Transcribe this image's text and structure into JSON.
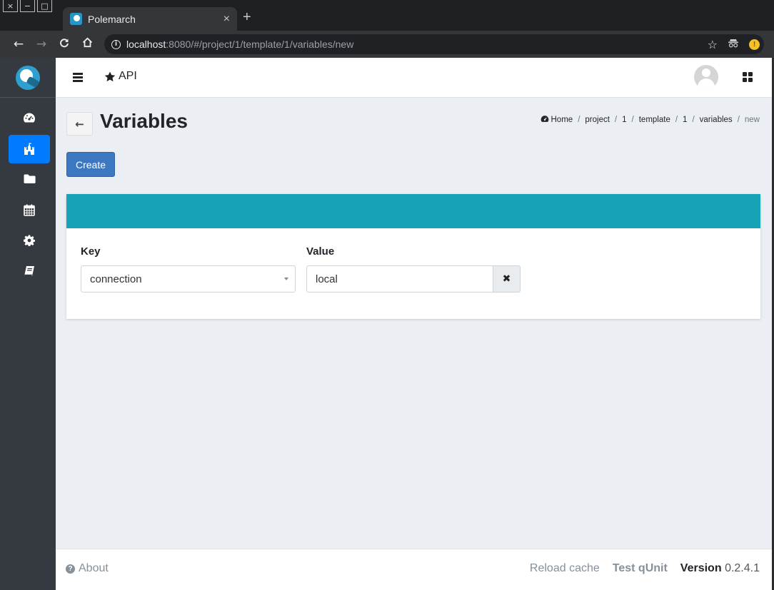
{
  "window": {
    "controls": [
      "×",
      "−",
      "□"
    ]
  },
  "browser": {
    "tab_title": "Polemarch",
    "tab_close": "×",
    "new_tab": "+",
    "url_host": "localhost",
    "url_rest": ":8080/#/project/1/template/1/variables/new"
  },
  "navbar": {
    "api_label": "API"
  },
  "sidebar": {
    "items": [
      {
        "icon": "dashboard-icon"
      },
      {
        "icon": "castle-icon",
        "active": true
      },
      {
        "icon": "folder-icon"
      },
      {
        "icon": "calendar-icon"
      },
      {
        "icon": "gear-icon"
      },
      {
        "icon": "book-icon"
      }
    ]
  },
  "page": {
    "title": "Variables",
    "breadcrumb": [
      "Home",
      "project",
      "1",
      "template",
      "1",
      "variables",
      "new"
    ],
    "create_label": "Create"
  },
  "form": {
    "header_color": "#17a2b8",
    "key_label": "Key",
    "key_value": "connection",
    "value_label": "Value",
    "value_value": "local"
  },
  "footer": {
    "about": "About",
    "reload": "Reload cache",
    "qunit": "Test qUnit",
    "version_label": "Version",
    "version_number": "0.2.4.1"
  },
  "colors": {
    "primary": "#007bff",
    "create_button": "#3c78c2",
    "sidebar_bg": "#343a40",
    "content_bg": "#ebeef3"
  }
}
